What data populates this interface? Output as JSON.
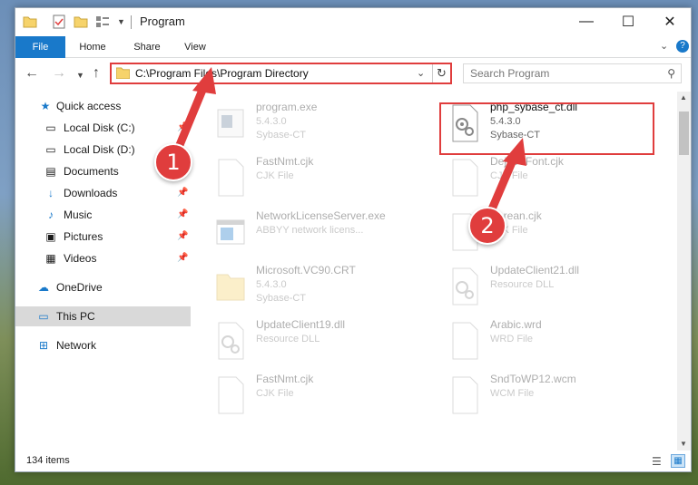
{
  "window": {
    "title": "Program",
    "controls": {
      "minimize": "—",
      "maximize": "☐",
      "close": "✕"
    }
  },
  "ribbon": {
    "tabs": [
      {
        "label": "File"
      },
      {
        "label": "Home"
      },
      {
        "label": "Share"
      },
      {
        "label": "View"
      }
    ],
    "help": "?"
  },
  "address_bar": {
    "path": "C:\\Program Files\\Program Directory"
  },
  "search": {
    "placeholder": "Search Program"
  },
  "sidebar": {
    "items": [
      {
        "label": "Quick access",
        "icon": "star-icon"
      },
      {
        "label": "Local Disk (C:)",
        "icon": "drive-icon"
      },
      {
        "label": "Local Disk (D:)",
        "icon": "drive-icon"
      },
      {
        "label": "Documents",
        "icon": "documents-icon"
      },
      {
        "label": "Downloads",
        "icon": "download-icon"
      },
      {
        "label": "Music",
        "icon": "music-icon"
      },
      {
        "label": "Pictures",
        "icon": "pictures-icon"
      },
      {
        "label": "Videos",
        "icon": "videos-icon"
      },
      {
        "label": "OneDrive",
        "icon": "cloud-icon"
      },
      {
        "label": "This PC",
        "icon": "computer-icon"
      },
      {
        "label": "Network",
        "icon": "network-icon"
      }
    ]
  },
  "files": [
    {
      "name": "program.exe",
      "line2": "5.4.3.0",
      "line3": "Sybase-CT",
      "icon": "exe-icon"
    },
    {
      "name": "php_sybase_ct.dll",
      "line2": "5.4.3.0",
      "line3": "Sybase-CT",
      "icon": "dll-gear-icon"
    },
    {
      "name": "FastNmt.cjk",
      "line2": "CJK File",
      "line3": "",
      "icon": "document-icon"
    },
    {
      "name": "DejaVuFont.cjk",
      "line2": "CJK File",
      "line3": "",
      "icon": "document-icon"
    },
    {
      "name": "NetworkLicenseServer.exe",
      "line2": "ABBYY network licens...",
      "line3": "",
      "icon": "exe-window-icon"
    },
    {
      "name": "Korean.cjk",
      "line2": "CJK File",
      "line3": "",
      "icon": "document-icon"
    },
    {
      "name": "Microsoft.VC90.CRT",
      "line2": "5.4.3.0",
      "line3": "Sybase-CT",
      "icon": "folder-icon"
    },
    {
      "name": "UpdateClient21.dll",
      "line2": "Resource DLL",
      "line3": "",
      "icon": "dll-gear-icon"
    },
    {
      "name": "UpdateClient19.dll",
      "line2": "Resource DLL",
      "line3": "",
      "icon": "dll-gear-icon"
    },
    {
      "name": "Arabic.wrd",
      "line2": "WRD File",
      "line3": "",
      "icon": "document-icon"
    },
    {
      "name": "FastNmt.cjk",
      "line2": "CJK File",
      "line3": "",
      "icon": "document-icon"
    },
    {
      "name": "SndToWP12.wcm",
      "line2": "WCM File",
      "line3": "",
      "icon": "document-icon"
    }
  ],
  "status": {
    "item_count": "134 items"
  },
  "annotations": {
    "step1": "1",
    "step2": "2",
    "accent_color": "#e03d3d"
  }
}
